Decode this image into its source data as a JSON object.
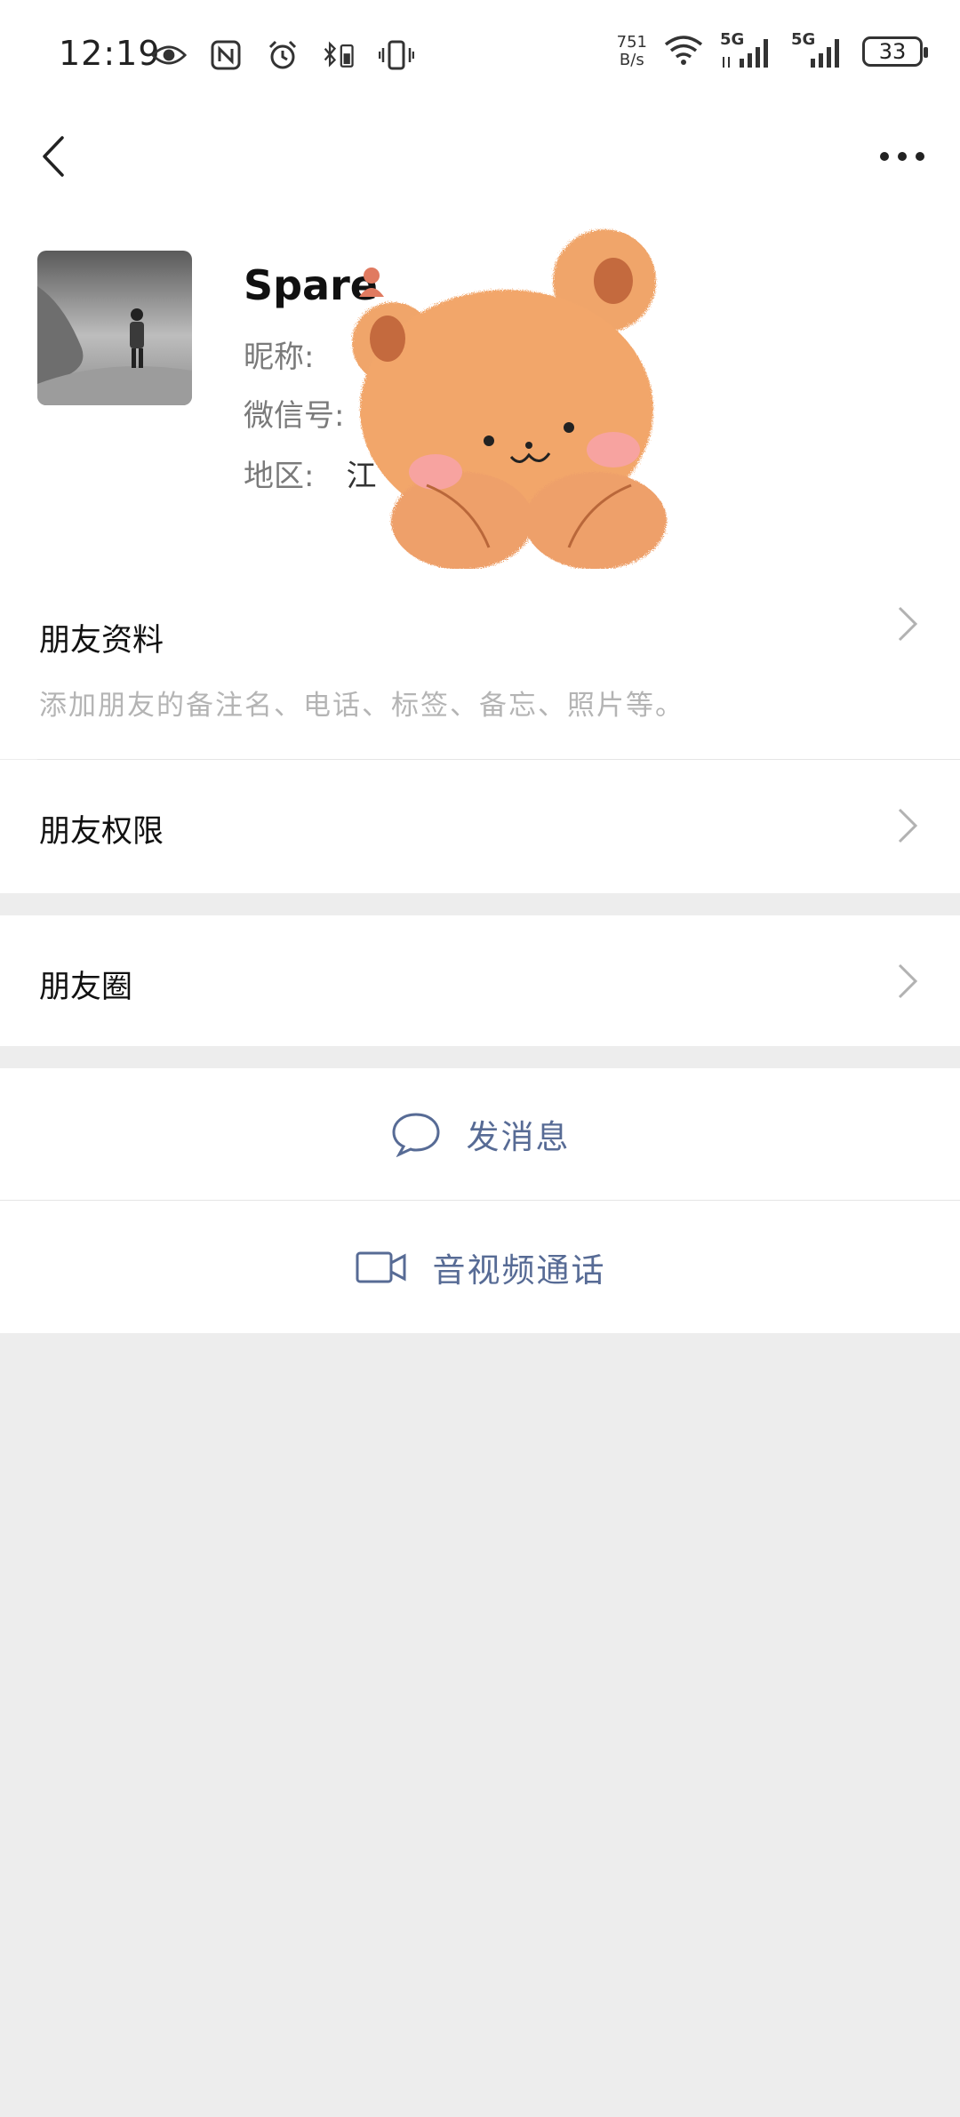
{
  "status_bar": {
    "time": "12:19",
    "net_speed_value": "751",
    "net_speed_unit": "B/s",
    "signal1_label": "5G",
    "signal2_label": "5G",
    "battery": "33",
    "icons_left": [
      "eye-icon",
      "nfc-icon",
      "alarm-icon",
      "bluetooth-icon",
      "vibrate-icon"
    ]
  },
  "header": {
    "back_icon": "chevron-left-icon",
    "more_icon": "more-dots-icon"
  },
  "profile": {
    "name": "Spare",
    "nickname_label": "昵称:",
    "wechat_id_label": "微信号:",
    "region_label": "地区:",
    "region_value": "江"
  },
  "rows": {
    "friend_info_title": "朋友资料",
    "friend_info_subtitle": "添加朋友的备注名、电话、标签、备忘、照片等。",
    "friend_permissions_title": "朋友权限",
    "moments_title": "朋友圈"
  },
  "actions": {
    "send_message": "发消息",
    "video_call": "音视频通话"
  },
  "colors": {
    "link_blue": "#576b95",
    "background": "#ededed",
    "card": "#ffffff"
  }
}
